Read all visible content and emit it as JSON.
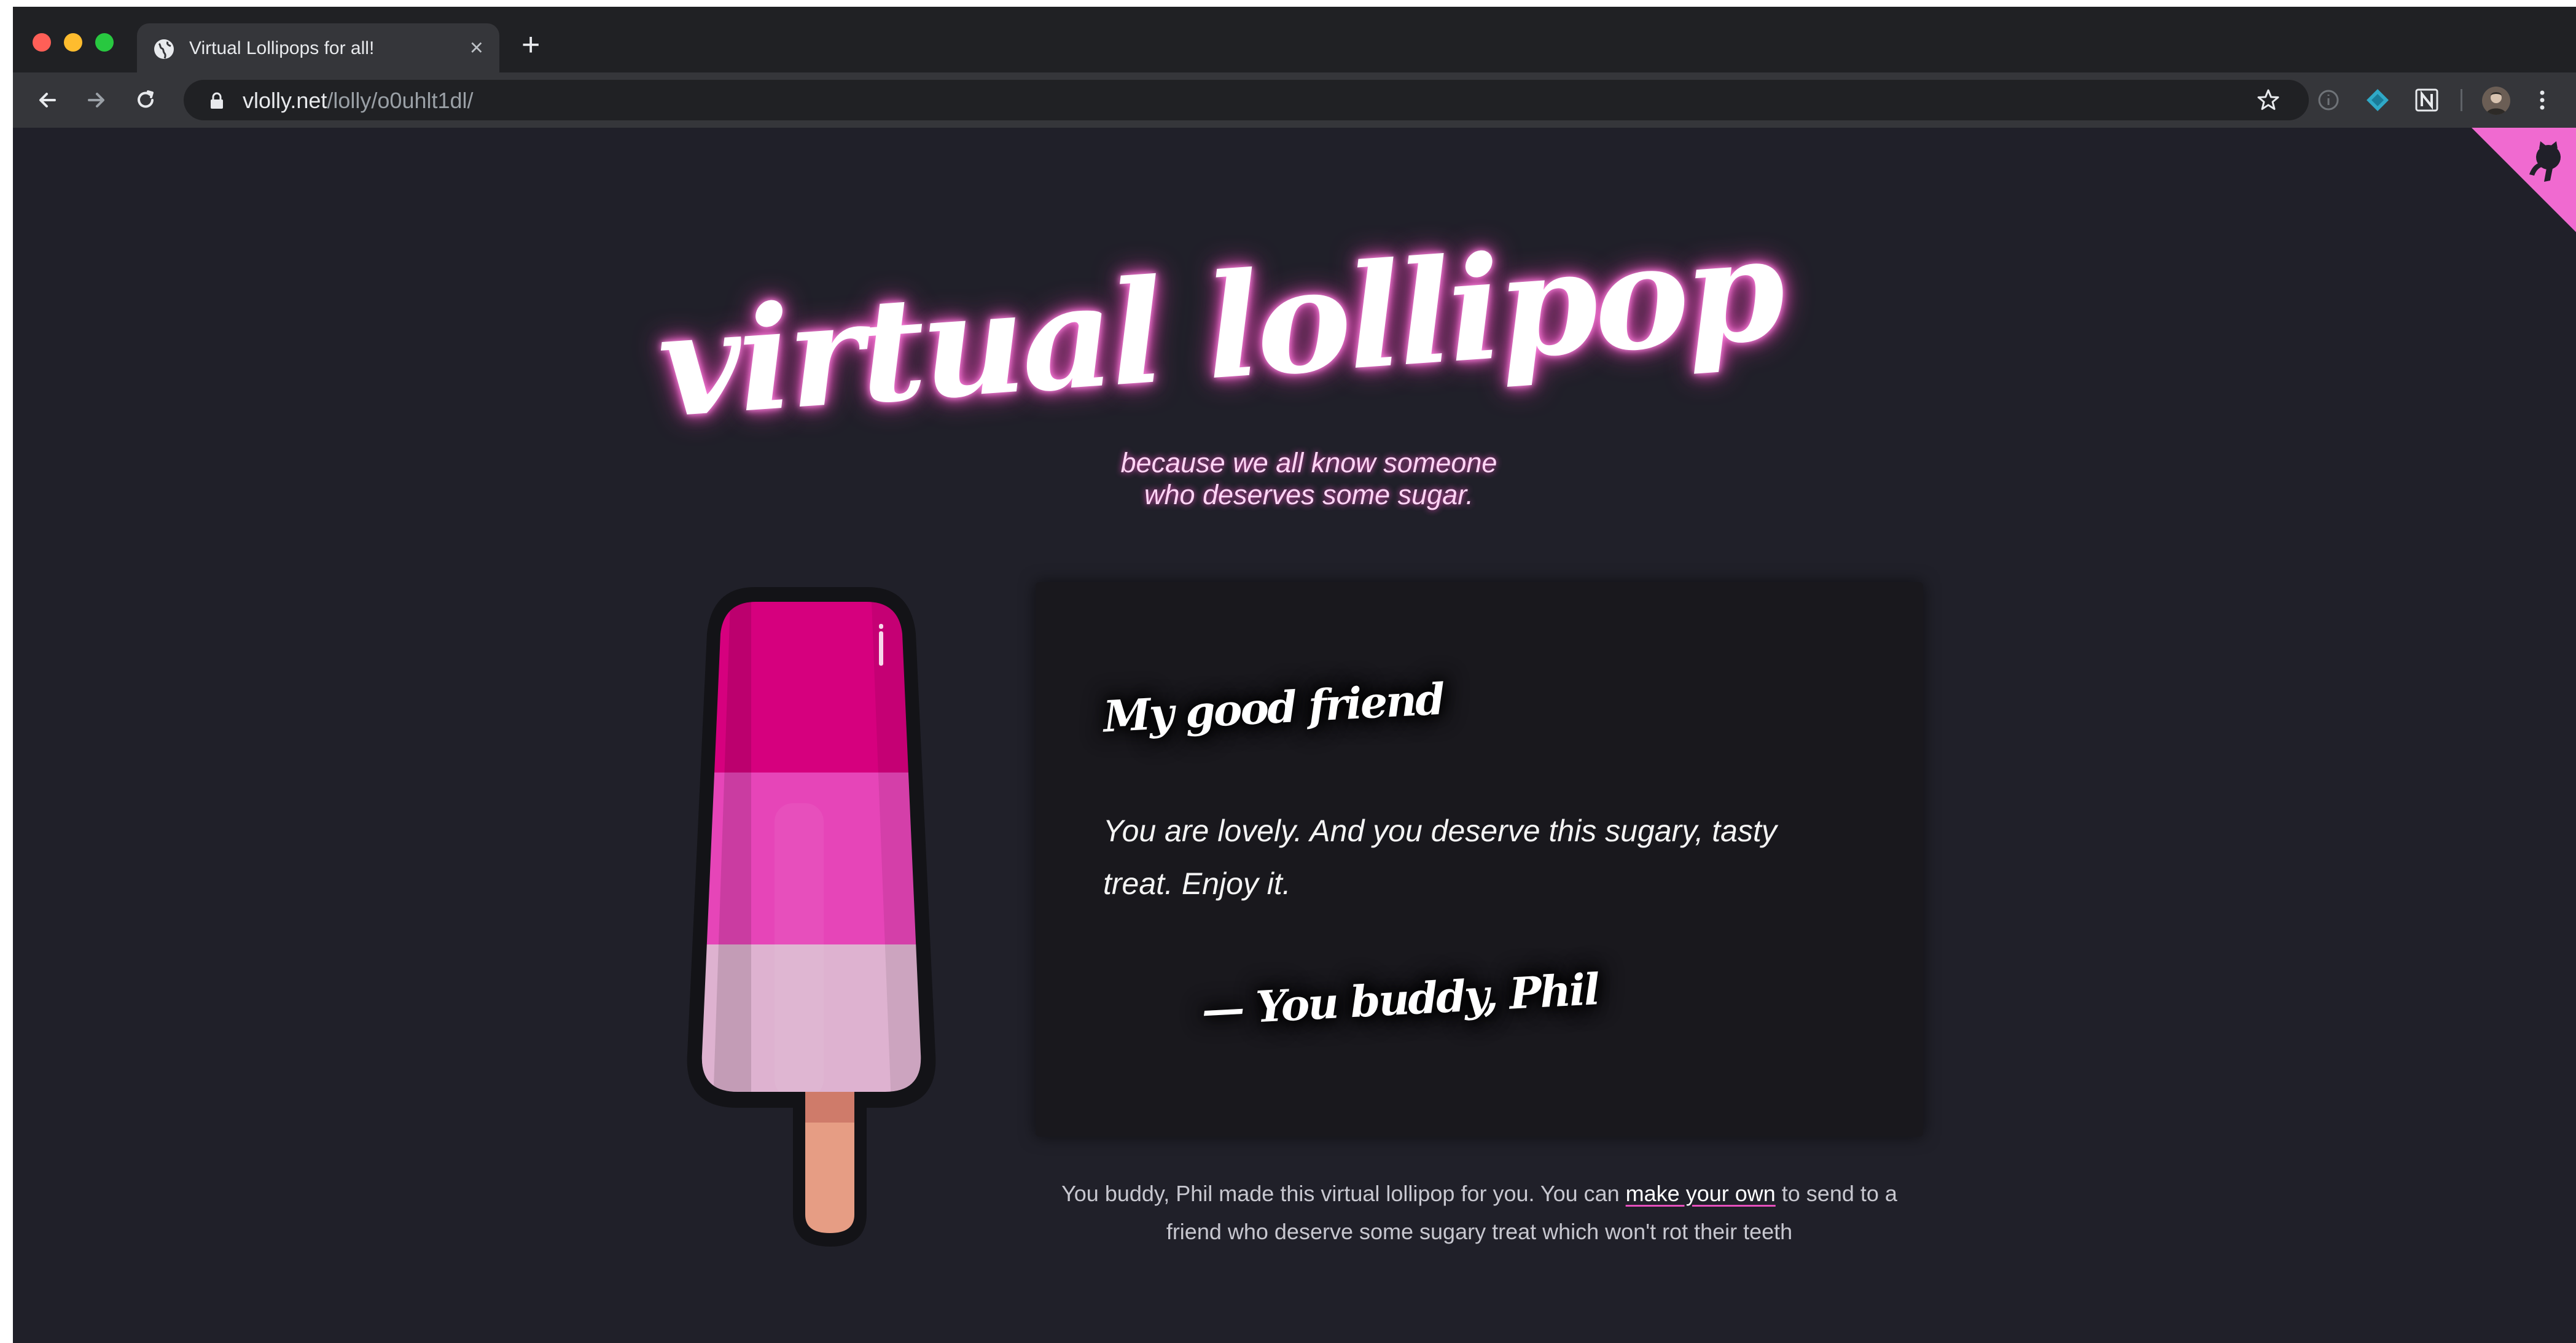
{
  "browser": {
    "tab": {
      "title": "Virtual Lollipops for all!",
      "close": "×"
    },
    "new_tab": "+",
    "address": {
      "host": "vlolly.net",
      "path": "/lolly/o0uhlt1dl/"
    }
  },
  "page": {
    "headline": "virtual lollipop",
    "subtitle_line1": "because we all know someone",
    "subtitle_line2": "who deserves some sugar.",
    "card": {
      "to": "My good friend",
      "message": "You are lovely. And you deserve this sugary, tasty treat. Enjoy it.",
      "from": "— You buddy, Phil"
    },
    "footer": {
      "before": "You buddy, Phil made this virtual lollipop for you. You can ",
      "link": "make your own",
      "after": " to send to a friend who deserve some sugary treat which won't rot their teeth"
    },
    "lolly_colors": {
      "top": "#d6007e",
      "middle": "#e645b8",
      "bottom": "#deb2d0",
      "stick": "#e69d84"
    },
    "corner_color": "#f06ad0"
  }
}
